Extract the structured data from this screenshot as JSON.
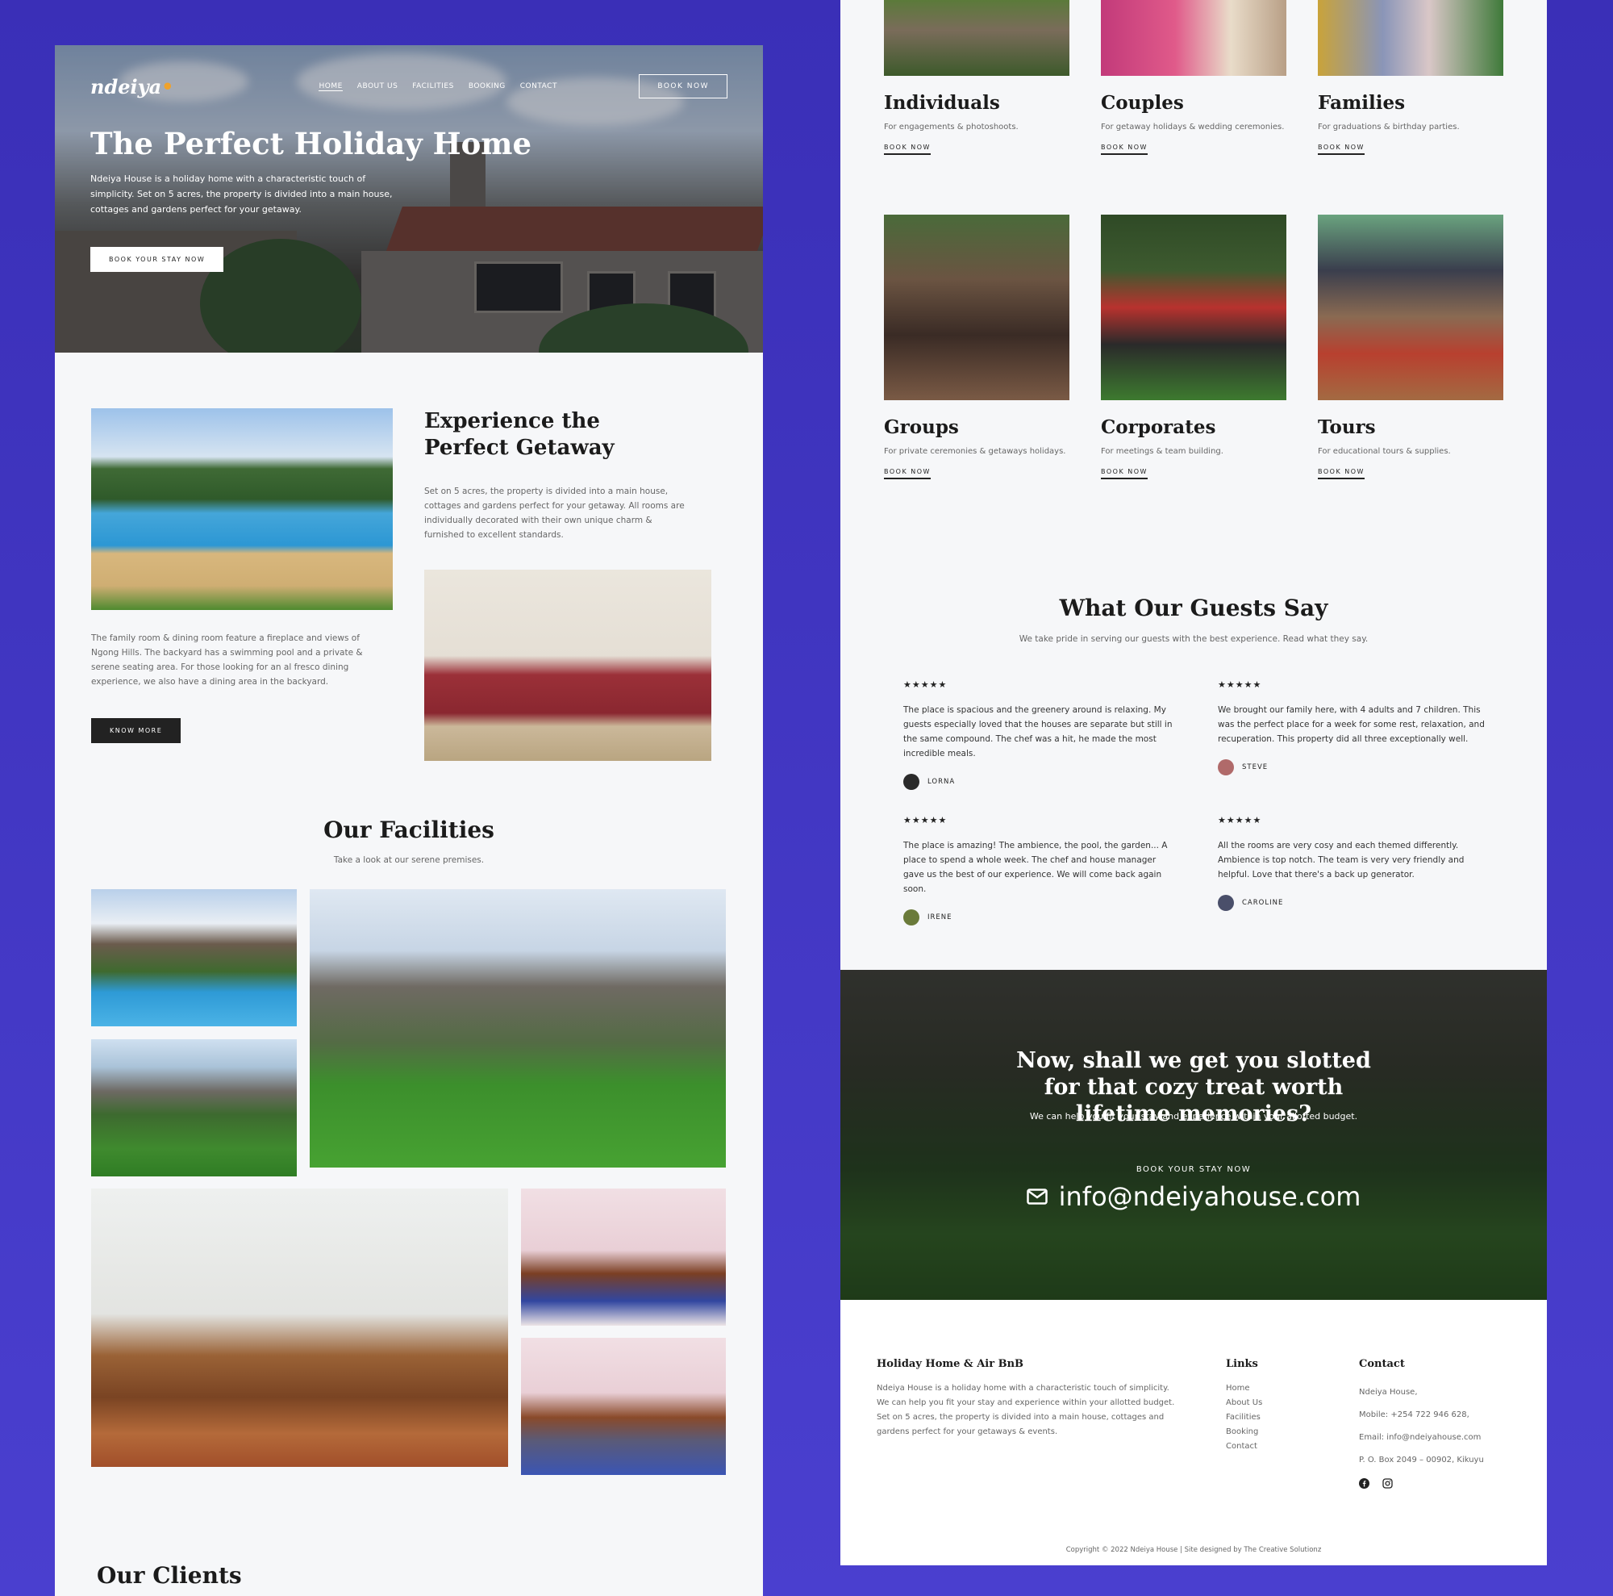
{
  "hero": {
    "logo": "ndeiya",
    "nav": [
      "HOME",
      "ABOUT US",
      "FACILITIES",
      "BOOKING",
      "CONTACT"
    ],
    "book_now": "BOOK NOW",
    "title": "The Perfect Holiday Home",
    "description": "Ndeiya House is a holiday home with a characteristic touch of simplicity. Set on 5 acres, the property is divided into a main house, cottages and gardens perfect for your getaway.",
    "cta": "BOOK YOUR STAY NOW"
  },
  "experience": {
    "title": "Experience the Perfect Getaway",
    "description": "Set on 5 acres, the property is divided into a main house, cottages and gardens perfect for your getaway. All rooms are individually decorated with their own unique charm & furnished to excellent standards.",
    "description2": "The family room & dining room feature a fireplace and views of Ngong Hills. The backyard has a swimming pool and a private & serene seating area. For those looking for an al fresco dining experience, we also have a dining area in the backyard.",
    "button": "KNOW MORE"
  },
  "facilities": {
    "title": "Our Facilities",
    "subtitle": "Take a look at our serene premises."
  },
  "clients": {
    "title": "Our Clients"
  },
  "services": [
    {
      "title": "Individuals",
      "desc": "For engagements & photoshoots.",
      "cta": "BOOK NOW"
    },
    {
      "title": "Couples",
      "desc": "For getaway holidays & wedding ceremonies.",
      "cta": "BOOK NOW"
    },
    {
      "title": "Families",
      "desc": "For graduations & birthday parties.",
      "cta": "BOOK NOW"
    },
    {
      "title": "Groups",
      "desc": "For private ceremonies & getaways holidays.",
      "cta": "BOOK NOW"
    },
    {
      "title": "Corporates",
      "desc": "For meetings & team building.",
      "cta": "BOOK NOW"
    },
    {
      "title": "Tours",
      "desc": "For educational tours & supplies.",
      "cta": "BOOK NOW"
    }
  ],
  "guests": {
    "title": "What Our Guests Say",
    "subtitle": "We take pride in serving our guests with the best experience. Read what they say.",
    "reviews": [
      {
        "stars": "★★★★★",
        "text": "The place is spacious and the greenery around is relaxing. My guests especially loved that the houses are separate but still in the same compound. The chef was a hit, he made the most incredible meals.",
        "name": "LORNA"
      },
      {
        "stars": "★★★★★",
        "text": "We brought our family here, with 4 adults and 7 children. This was the perfect place for a week for some rest, relaxation, and recuperation. This property did all three exceptionally well.",
        "name": "STEVE"
      },
      {
        "stars": "★★★★★",
        "text": "The place is amazing! The ambience, the pool, the garden... A place to spend a whole week. The chef and house manager gave us the best of our experience. We will come back again soon.",
        "name": "IRENE"
      },
      {
        "stars": "★★★★★",
        "text": "All the rooms are very cosy and each themed differently. Ambience is top notch. The team is very very friendly and helpful. Love that there's a back up generator.",
        "name": "CAROLINE"
      }
    ]
  },
  "cta": {
    "title": "Now, shall we get you slotted for that cozy treat worth lifetime memories?",
    "subtitle": "We can help you fit your stay and experience within your allotted budget.",
    "label": "BOOK YOUR STAY NOW",
    "email": "info@ndeiyahouse.com"
  },
  "footer": {
    "about_title": "Holiday Home & Air BnB",
    "about_text": "Ndeiya House is a holiday home with a characteristic touch of simplicity. We can help you fit your stay and experience within your allotted budget. Set on 5 acres, the property is divided into a main house, cottages and gardens perfect for your getaways & events.",
    "links_title": "Links",
    "links": [
      "Home",
      "About Us",
      "Facilities",
      "Booking",
      "Contact"
    ],
    "contact_title": "Contact",
    "contact": [
      "Ndeiya House,",
      "Mobile: +254 722 946 628,",
      "Email: info@ndeiyahouse.com",
      "P. O. Box 2049 – 00902, Kikuyu"
    ],
    "copyright": "Copyright © 2022 Ndeiya House | Site designed by The Creative Solutionz"
  },
  "colors": {
    "background": "#3a2fb7",
    "page": "#f6f7f9",
    "text": "#1b1b1b"
  },
  "icons": [
    "facebook-icon",
    "instagram-icon",
    "envelope-icon",
    "star-icon"
  ]
}
